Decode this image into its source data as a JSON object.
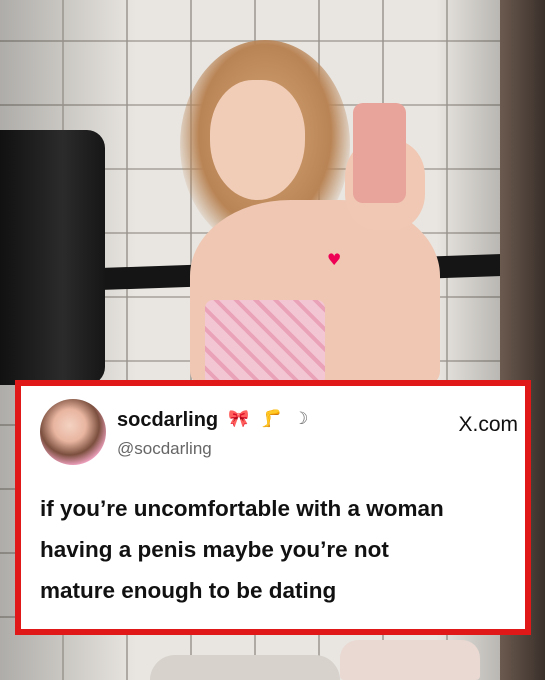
{
  "tweet": {
    "display_name": "socdarling",
    "name_emojis": [
      "🎀",
      "🦵",
      "☽"
    ],
    "handle": "@socdarling",
    "source_badge": "X.com",
    "text": "if you’re uncomfortable with a woman\nhaving a penis maybe you’re not\nmature enough to be dating"
  },
  "colors": {
    "card_border": "#e01818",
    "card_background": "#ffffff"
  },
  "icons": {
    "pride_sticker": "rainbow-heart-icon"
  }
}
